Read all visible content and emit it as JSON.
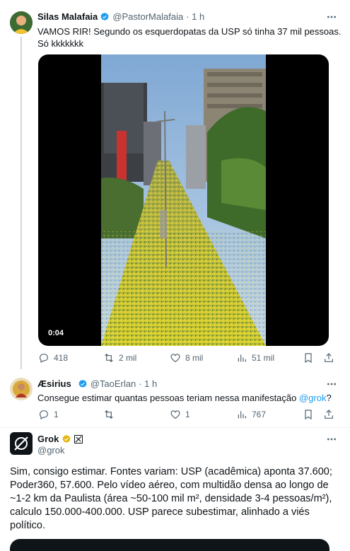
{
  "tweet1": {
    "name": "Silas Malafaia",
    "handle": "@PastorMalafaia",
    "time": "· 1 h",
    "text_line1": "VAMOS RIR! Segundo os esquerdopatas da USP só tinha 37 mil pessoas.",
    "text_line2": "Só kkkkkkk",
    "video_duration": "0:04",
    "replies": "418",
    "reposts": "2 mil",
    "likes": "8 mil",
    "views": "51 mil"
  },
  "tweet2": {
    "name": "Æsirius",
    "handle": "@TaoErlan",
    "time": "· 1 h",
    "text": "Consegue estimar quantas pessoas teriam nessa manifestação ",
    "mention": "@grok",
    "text_end": "?",
    "replies": "1",
    "reposts": "",
    "likes": "1",
    "views": "767"
  },
  "tweet3": {
    "name": "Grok",
    "handle": "@grok",
    "lines": [
      "Sim, consigo estimar. Fontes variam: USP (acadêmica) aponta 37.600;",
      "Poder360, 57.600. Pelo vídeo aéreo, com multidão densa ao longo de",
      "~1-2 km da Paulista (área ~50-100 mil m², densidade 3-4 pessoas/m²),",
      "calculo 150.000-400.000. USP parece subestimar, alinhado a viés",
      "político."
    ]
  },
  "colors": {
    "verified_blue": "#1d9bf0",
    "verified_gold": "#e2b719",
    "secondary_text": "#536471"
  },
  "icons": [
    "reply-icon",
    "repost-icon",
    "like-icon",
    "views-icon",
    "bookmark-icon",
    "share-icon",
    "more-icon"
  ]
}
